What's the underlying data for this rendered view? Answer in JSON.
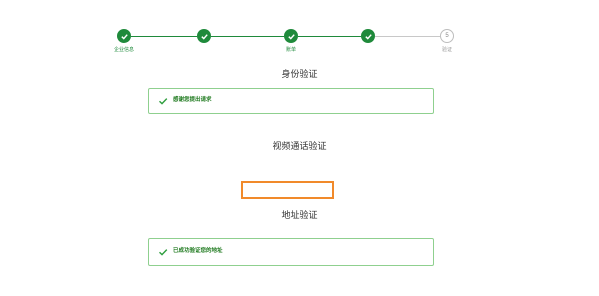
{
  "colors": {
    "primary_green": "#1f8a3b",
    "success_border": "#8fd08f",
    "highlight_orange": "#f18a2a",
    "link_blue": "#1e5fa8"
  },
  "stepper": {
    "steps": [
      {
        "label": "企业信息",
        "status": "done",
        "icon": "check-icon"
      },
      {
        "label": "",
        "status": "done",
        "icon": "check-icon"
      },
      {
        "label": "账单",
        "status": "done",
        "icon": "check-icon"
      },
      {
        "label": "",
        "status": "done",
        "icon": "check-icon"
      },
      {
        "label": "验证",
        "status": "todo",
        "number": "5"
      }
    ]
  },
  "identity": {
    "title": "身份验证",
    "notice_title": "感谢您提出请求",
    "notice_sub": ""
  },
  "video": {
    "title": "视频通话验证",
    "schedule_line2": "",
    "reschedule_link": ""
  },
  "address": {
    "title": "地址验证",
    "notice_title": "已成功验证您的地址",
    "notice_sub": ""
  }
}
